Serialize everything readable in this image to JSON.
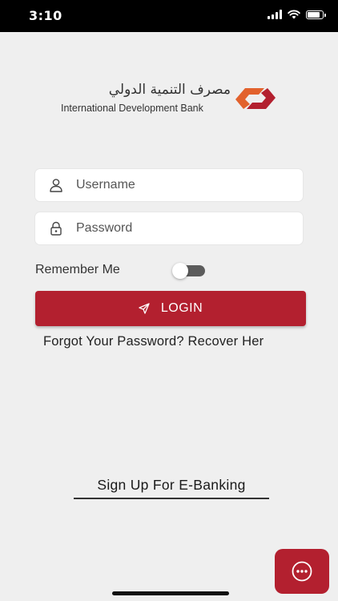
{
  "status_bar": {
    "time": "3:10",
    "signal_icon": "signal-icon",
    "wifi_icon": "wifi-icon",
    "battery_icon": "battery-icon",
    "battery_level": 0.85
  },
  "logo": {
    "arabic_text": "مصرف التنمية الدولي",
    "english_text": "International Development Bank",
    "mark_icon": "bank-logo-mark",
    "mark_color": "#e2622d"
  },
  "login_form": {
    "username": {
      "placeholder": "Username",
      "value": "",
      "icon": "user-icon"
    },
    "password": {
      "placeholder": "Password",
      "value": "",
      "icon": "lock-icon"
    },
    "remember_me": {
      "label": "Remember Me",
      "checked": false
    },
    "login_button": {
      "label": "LOGIN",
      "icon": "send-icon"
    },
    "forgot_link": "Forgot Your Password? Recover Her"
  },
  "signup_link": "Sign Up For E-Banking",
  "chat_button": {
    "icon": "chat-bubble-icon"
  },
  "colors": {
    "accent": "#b3202f",
    "background": "#efefef",
    "toggle_track": "#5c5c5c"
  }
}
